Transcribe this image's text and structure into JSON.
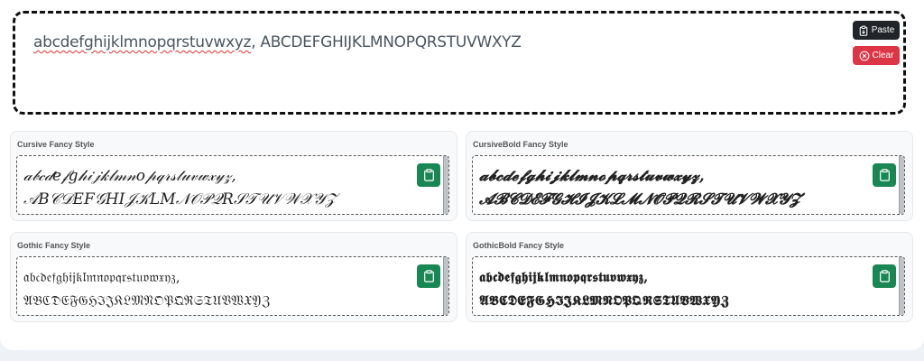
{
  "input": {
    "text_misspelled": "abcdefghijklmnopqrstuvwxyz",
    "text_rest": ", ABCDEFGHIJKLMNOPQRSTUVWXYZ"
  },
  "buttons": {
    "paste_label": "Paste",
    "clear_label": "Clear",
    "paste_color": "#212529",
    "clear_color": "#dc3545",
    "copy_color": "#198754"
  },
  "cards": [
    {
      "title": "Cursive Fancy Style",
      "line1": "𝒶𝒷𝒸𝒹𝑒𝒻𝑔𝒽𝒾𝒿𝓀𝓁𝓂𝓃𝑜𝓅𝓆𝓇𝓈𝓉𝓊𝓋𝓌𝓍𝓎𝓏,",
      "line2": "𝒜𝐵𝒞𝒟𝐸𝐹𝒢𝐻𝐼𝒥𝒦𝐿𝑀𝒩𝒪𝒫𝒬𝑅𝒮𝒯𝒰𝒱𝒲𝒳𝒴𝒵"
    },
    {
      "title": "CursiveBold Fancy Style",
      "line1": "𝓪𝓫𝓬𝓭𝓮𝓯𝓰𝓱𝓲𝓳𝓴𝓵𝓶𝓷𝓸𝓹𝓺𝓻𝓼𝓽𝓾𝓿𝔀𝔁𝔂𝔃,",
      "line2": "𝓐𝓑𝓒𝓓𝓔𝓕𝓖𝓗𝓘𝓙𝓚𝓛𝓜𝓝𝓞𝓟𝓠𝓡𝓢𝓣𝓤𝓥𝓦𝓧𝓨𝓩"
    },
    {
      "title": "Gothic Fancy Style",
      "line1": "𝔞𝔟𝔠𝔡𝔢𝔣𝔤𝔥𝔦𝔧𝔨𝔩𝔪𝔫𝔬𝔭𝔮𝔯𝔰𝔱𝔲𝔳𝔴𝔵𝔶𝔷,",
      "line2": "𝔄𝔅ℭ𝔇𝔈𝔉𝔊ℌℑ𝔍𝔎𝔏𝔐𝔑𝔒𝔓𝔔ℜ𝔖𝔗𝔘𝔙𝔚𝔛𝔜ℨ"
    },
    {
      "title": "GothicBold Fancy Style",
      "line1": "𝖆𝖇𝖈𝖉𝖊𝖋𝖌𝖍𝖎𝖏𝖐𝖑𝖒𝖓𝖔𝖕𝖖𝖗𝖘𝖙𝖚𝖛𝖜𝖝𝖞𝖟,",
      "line2": "𝕬𝕭𝕮𝕯𝕰𝕱𝕲𝕳𝕴𝕵𝕶𝕷𝕸𝕹𝕺𝕻𝕼𝕽𝕾𝕿𝖀𝖁𝖂𝖃𝖄𝖅"
    }
  ]
}
